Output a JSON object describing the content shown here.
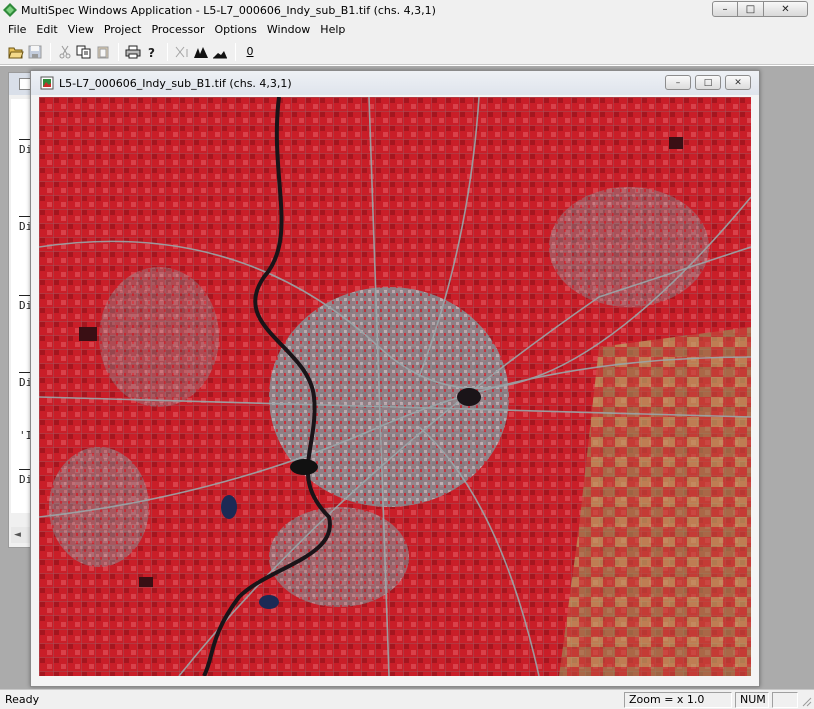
{
  "window": {
    "title": "MultiSpec Windows Application - L5-L7_000606_Indy_sub_B1.tif (chs. 4,3,1)",
    "minimize_glyph": "–",
    "maximize_glyph": "□",
    "close_glyph": "✕"
  },
  "menu": [
    "File",
    "Edit",
    "View",
    "Project",
    "Processor",
    "Options",
    "Window",
    "Help"
  ],
  "toolbar": {
    "zero_label": "0"
  },
  "text_window": {
    "lines": [
      "Di",
      "Di",
      "Di",
      "Di",
      "'I",
      "Di"
    ],
    "scroll_left_glyph": "◄"
  },
  "image_window": {
    "title": "L5-L7_000606_Indy_sub_B1.tif (chs. 4,3,1)",
    "minimize_glyph": "–",
    "maximize_glyph": "□",
    "close_glyph": "✕"
  },
  "status": {
    "left": "Ready",
    "zoom": "Zoom = x 1.0",
    "num": "NUM"
  },
  "colors": {
    "vegetation_red": "#d0202a",
    "urban_cyan": "#8fb3b8",
    "river_dark": "#1a1418",
    "field_tan": "#b8b06a"
  },
  "icons": {
    "app": "multispec-diamond-icon",
    "image_doc": "image-document-icon"
  }
}
